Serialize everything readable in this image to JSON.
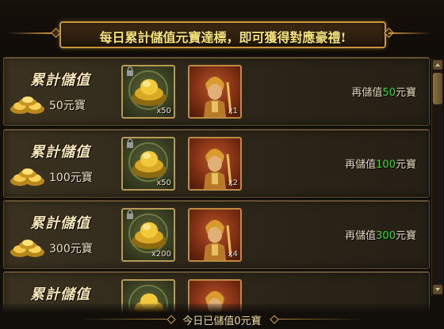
{
  "banner": {
    "text": "每日累計儲值元寶達標，即可獲得對應豪禮!"
  },
  "rows": [
    {
      "title": "累計儲值",
      "amount": "50元寶",
      "reward1_qty": "x50",
      "reward2_qty": "x1",
      "status_prefix": "再儲值",
      "status_num": "50",
      "status_suffix": "元寶"
    },
    {
      "title": "累計儲值",
      "amount": "100元寶",
      "reward1_qty": "x50",
      "reward2_qty": "x2",
      "status_prefix": "再儲值",
      "status_num": "100",
      "status_suffix": "元寶"
    },
    {
      "title": "累計儲值",
      "amount": "300元寶",
      "reward1_qty": "x200",
      "reward2_qty": "x4",
      "status_prefix": "再儲值",
      "status_num": "300",
      "status_suffix": "元寶"
    },
    {
      "title": "累計儲值",
      "amount": "",
      "reward1_qty": "",
      "reward2_qty": "",
      "status_prefix": "",
      "status_num": "",
      "status_suffix": ""
    }
  ],
  "footer": {
    "text": "今日已儲值0元寶"
  },
  "icons": {
    "currency": "gold-ingot-icon",
    "reward1": "gold-ingot-item-icon",
    "reward2": "warrior-portrait-icon",
    "lock": "lock-icon"
  },
  "colors": {
    "highlight_number": "#3fd43a",
    "banner_text": "#f6e27a",
    "frame": "#c8963c"
  }
}
